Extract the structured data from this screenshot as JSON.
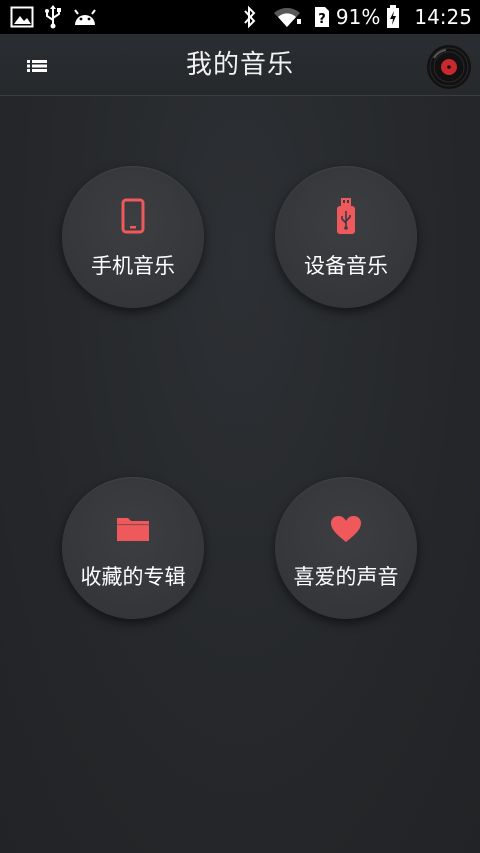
{
  "status_bar": {
    "battery_text": "91%",
    "time": "14:25",
    "icons": [
      "gallery-icon",
      "usb-icon",
      "android-icon",
      "bluetooth-icon",
      "wifi-icon",
      "sim-icon",
      "battery-charging-icon"
    ]
  },
  "header": {
    "title": "我的音乐",
    "menu_icon": "menu-list-icon",
    "record_icon": "vinyl-record-icon"
  },
  "tiles": [
    {
      "label": "手机音乐",
      "icon": "phone-icon"
    },
    {
      "label": "设备音乐",
      "icon": "usb-drive-icon"
    },
    {
      "label": "收藏的专辑",
      "icon": "folder-icon"
    },
    {
      "label": "喜爱的声音",
      "icon": "heart-icon"
    }
  ],
  "colors": {
    "accent": "#f0595c",
    "background": "#25272a",
    "statusbar": "#000000",
    "tile": "#3a3c40"
  }
}
